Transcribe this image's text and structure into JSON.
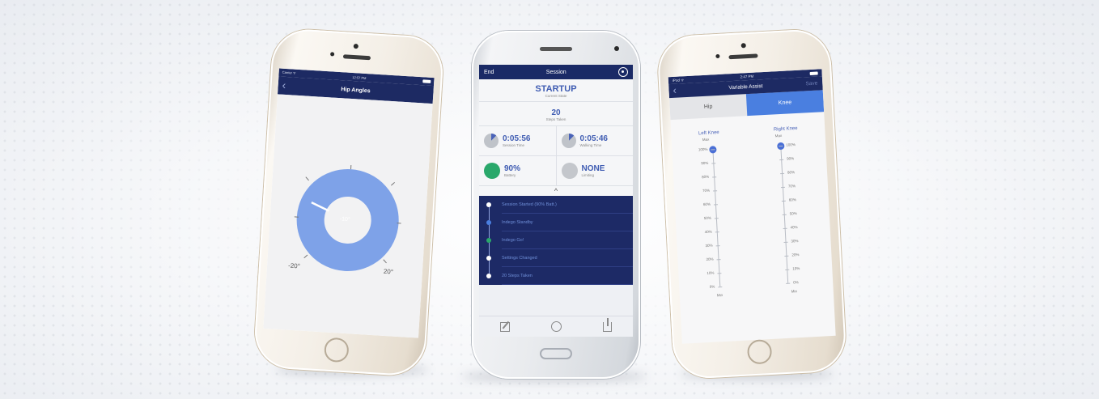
{
  "phone1": {
    "status_left": "Carrier ᯤ",
    "status_time": "12:57 PM",
    "nav_title": "Hip Angles",
    "back_glyph": "‹",
    "center_value": "-10°",
    "min_label": "-20°",
    "max_label": "20°"
  },
  "phone2": {
    "end_label": "End",
    "title": "Session",
    "state_value": "STARTUP",
    "state_label": "Current State",
    "steps_value": "20",
    "steps_label": "Steps Taken",
    "session_time": "0:05:56",
    "session_time_label": "Session Time",
    "walking_time": "0:05:46",
    "walking_time_label": "Walking Time",
    "battery_value": "90%",
    "battery_label": "Battery",
    "limiting_value": "NONE",
    "limiting_label": "Limiting",
    "chevron": "^",
    "log": [
      {
        "text": "Session Started (90% Batt.)",
        "color": "#ffffff"
      },
      {
        "text": "Indego Standby",
        "color": "#4a7fe0"
      },
      {
        "text": "Indego Go!",
        "color": "#2aa86b"
      },
      {
        "text": "Settings Changed",
        "color": "#ffffff"
      },
      {
        "text": "20 Steps Taken",
        "color": "#ffffff"
      }
    ],
    "tab_icons": [
      "edit-icon",
      "gauge-icon",
      "share-icon"
    ]
  },
  "phone3": {
    "status_left": "iPod ᯤ",
    "status_time": "2:47 PM",
    "nav_title": "Variable Assist",
    "back_glyph": "‹",
    "save_label": "Save",
    "tab_hip": "Hip",
    "tab_knee": "Knee",
    "left_knee": "Left Knee",
    "right_knee": "Right Knee",
    "max_label": "Max",
    "min_label": "Min",
    "left_level": 1.0,
    "right_level": 1.0,
    "percent_ticks": [
      "100%",
      "90%",
      "80%",
      "70%",
      "60%",
      "50%",
      "40%",
      "30%",
      "20%",
      "10%",
      "0%"
    ]
  },
  "colors": {
    "navy": "#1d2a63",
    "accent": "#4a6fd6",
    "ring": "#7ea2e8",
    "battery_green": "#2aa86b"
  }
}
